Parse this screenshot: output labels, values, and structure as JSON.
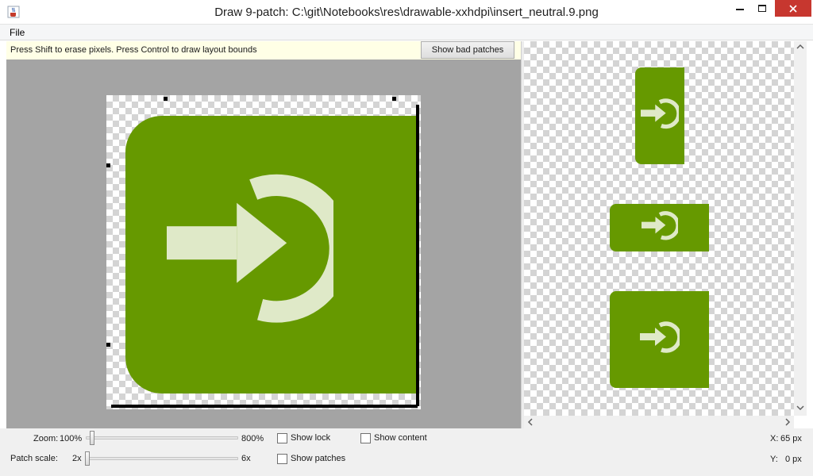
{
  "window": {
    "title": "Draw 9-patch: C:\\git\\Notebooks\\res\\drawable-xxhdpi\\insert_neutral.9.png"
  },
  "menu": {
    "file_label": "File"
  },
  "editor": {
    "hint": "Press Shift to erase pixels. Press Control to draw layout bounds",
    "bad_patches_button": "Show bad patches"
  },
  "controls": {
    "zoom_label": "Zoom:",
    "zoom_value": "100%",
    "zoom_max": "800%",
    "zoom_level": 0.1,
    "patch_scale_label": "Patch scale:",
    "patch_scale_min": "2x",
    "patch_scale_max": "6x",
    "patch_scale_level": 0.0,
    "show_lock": "Show lock",
    "show_content": "Show content",
    "show_patches": "Show patches",
    "show_lock_checked": false,
    "show_content_checked": false,
    "show_patches_checked": false
  },
  "coords": {
    "x_label": "X:",
    "x_value": "65 px",
    "y_label": "Y:",
    "y_value": "0 px"
  },
  "colors": {
    "tile_green": "#669900",
    "glyph_light": "#dfe9c8",
    "close_red": "#c7372f"
  },
  "icons": {
    "app": "java-cup-icon",
    "glyph": "sign-in-arrow-icon"
  }
}
